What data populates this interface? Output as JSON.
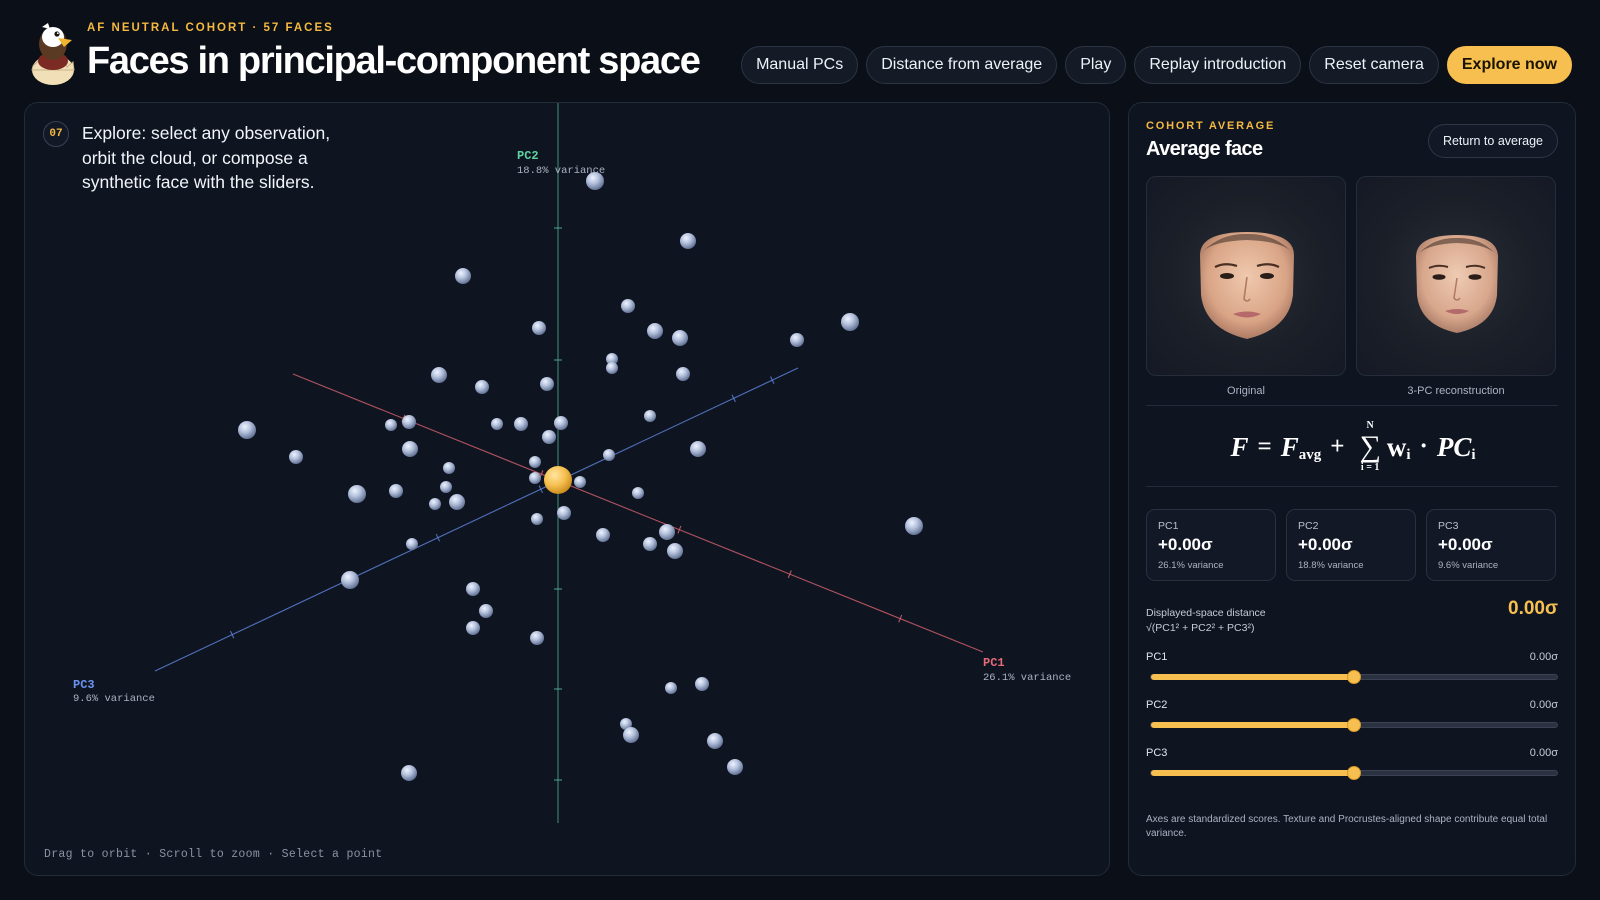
{
  "header": {
    "eyebrow": "AF NEUTRAL COHORT · 57 FACES",
    "title": "Faces in principal-component space"
  },
  "toolbar": {
    "buttons": [
      "Manual PCs",
      "Distance from average",
      "Play",
      "Replay introduction",
      "Reset camera",
      "Explore now"
    ],
    "primary_color": "#f6bf4f"
  },
  "scene": {
    "step": "07",
    "step_text": "Explore: select any observation, orbit the cloud, or compose a synthetic face with the sliders.",
    "axes": {
      "pc1": {
        "name": "PC1",
        "variance": "26.1% variance",
        "color": "#e36b78"
      },
      "pc2": {
        "name": "PC2",
        "variance": "18.8% variance",
        "color": "#5fd3a0"
      },
      "pc3": {
        "name": "PC3",
        "variance": "9.6% variance",
        "color": "#6b93f0"
      }
    },
    "hint": "Drag to orbit · Scroll to zoom · Select a point",
    "point_color": "#b6c3dd",
    "average_point_color": "#f6bf4f"
  },
  "sidebar": {
    "eyebrow": "COHORT AVERAGE",
    "title": "Average face",
    "return_label": "Return to average",
    "faces": [
      {
        "caption": "Original"
      },
      {
        "caption": "3-PC reconstruction"
      }
    ],
    "formula": {
      "lhs": "F",
      "eq": "=",
      "f": "F",
      "f_sub": "avg",
      "plus": "+",
      "sigma_top": "N",
      "sigma": "∑",
      "sigma_bottom": "i = 1",
      "w": "w",
      "w_sub": "i",
      "dot": "·",
      "pc": "PC",
      "pc_sub": "i"
    },
    "pc_cards": [
      {
        "label": "PC1",
        "value": "+0.00σ",
        "variance": "26.1% variance"
      },
      {
        "label": "PC2",
        "value": "+0.00σ",
        "variance": "18.8% variance"
      },
      {
        "label": "PC3",
        "value": "+0.00σ",
        "variance": "9.6% variance"
      }
    ],
    "distance": {
      "label": "Displayed-space distance",
      "formula": "√(PC1² + PC2² + PC3²)",
      "value": "0.00σ"
    },
    "sliders": [
      {
        "name": "PC1",
        "value": "0.00σ",
        "position": 0.5
      },
      {
        "name": "PC2",
        "value": "0.00σ",
        "position": 0.5
      },
      {
        "name": "PC3",
        "value": "0.00σ",
        "position": 0.5
      }
    ],
    "note": "Axes are standardized scores. Texture and Procrustes-aligned shape contribute equal total variance."
  }
}
